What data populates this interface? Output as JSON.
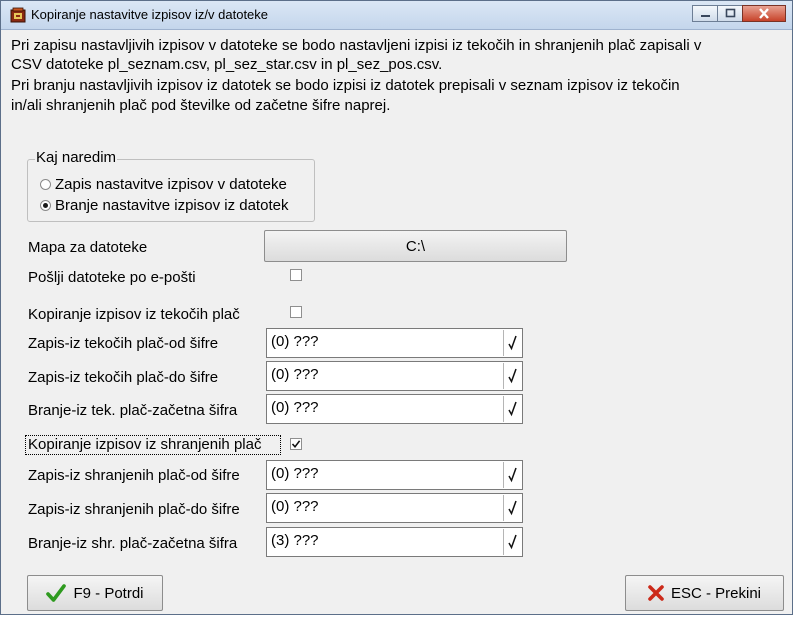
{
  "window": {
    "title": "Kopiranje nastavitve izpisov iz/v datoteke",
    "app_icon": "folder-icon",
    "controls": [
      "minimize-icon",
      "maximize-icon",
      "close-icon"
    ]
  },
  "description": {
    "line1": "Pri zapisu nastavljivih izpisov v datoteke se bodo nastavljeni izpisi iz tekočih in shranjenih plač zapisali v",
    "line2": "CSV datoteke pl_seznam.csv, pl_sez_star.csv in pl_sez_pos.csv.",
    "line3": "Pri branju nastavljivih izpisov iz datotek se bodo izpisi iz datotek prepisali v seznam izpisov iz tekočin",
    "line4": "in/ali shranjenih plač pod številke od začetne šifre naprej."
  },
  "action_group": {
    "legend": "Kaj naredim",
    "options": [
      {
        "label": "Zapis nastavitve izpisov v datoteke",
        "checked": false
      },
      {
        "label": "Branje nastavitve izpisov iz datotek",
        "checked": true
      }
    ]
  },
  "folder": {
    "label": "Mapa za datoteke",
    "value": "C:\\"
  },
  "email": {
    "label": "Pošlji datoteke po e-pošti",
    "checked": false
  },
  "current": {
    "label": "Kopiranje izpisov iz tekočih plač",
    "checked": false,
    "fields": [
      {
        "label": "Zapis-iz tekočih plač-od šifre",
        "value": "(0) ???"
      },
      {
        "label": "Zapis-iz tekočih plač-do šifre",
        "value": "(0) ???"
      },
      {
        "label": "Branje-iz tek. plač-začetna šifra",
        "value": "(0) ???"
      }
    ]
  },
  "saved": {
    "label": "Kopiranje izpisov iz shranjenih plač",
    "checked": true,
    "fields": [
      {
        "label": "Zapis-iz shranjenih plač-od šifre",
        "value": "(0) ???"
      },
      {
        "label": "Zapis-iz shranjenih plač-do šifre",
        "value": "(0) ???"
      },
      {
        "label": "Branje-iz shr. plač-začetna šifra",
        "value": "(3) ???"
      }
    ]
  },
  "buttons": {
    "confirm": {
      "label": "F9 - Potrdi",
      "icon": "checkmark-icon",
      "color": "#2e9a1f"
    },
    "cancel": {
      "label": "ESC - Prekini",
      "icon": "x-icon",
      "color": "#cc2a1a"
    }
  },
  "field_picker_icon": "check-picker-icon"
}
